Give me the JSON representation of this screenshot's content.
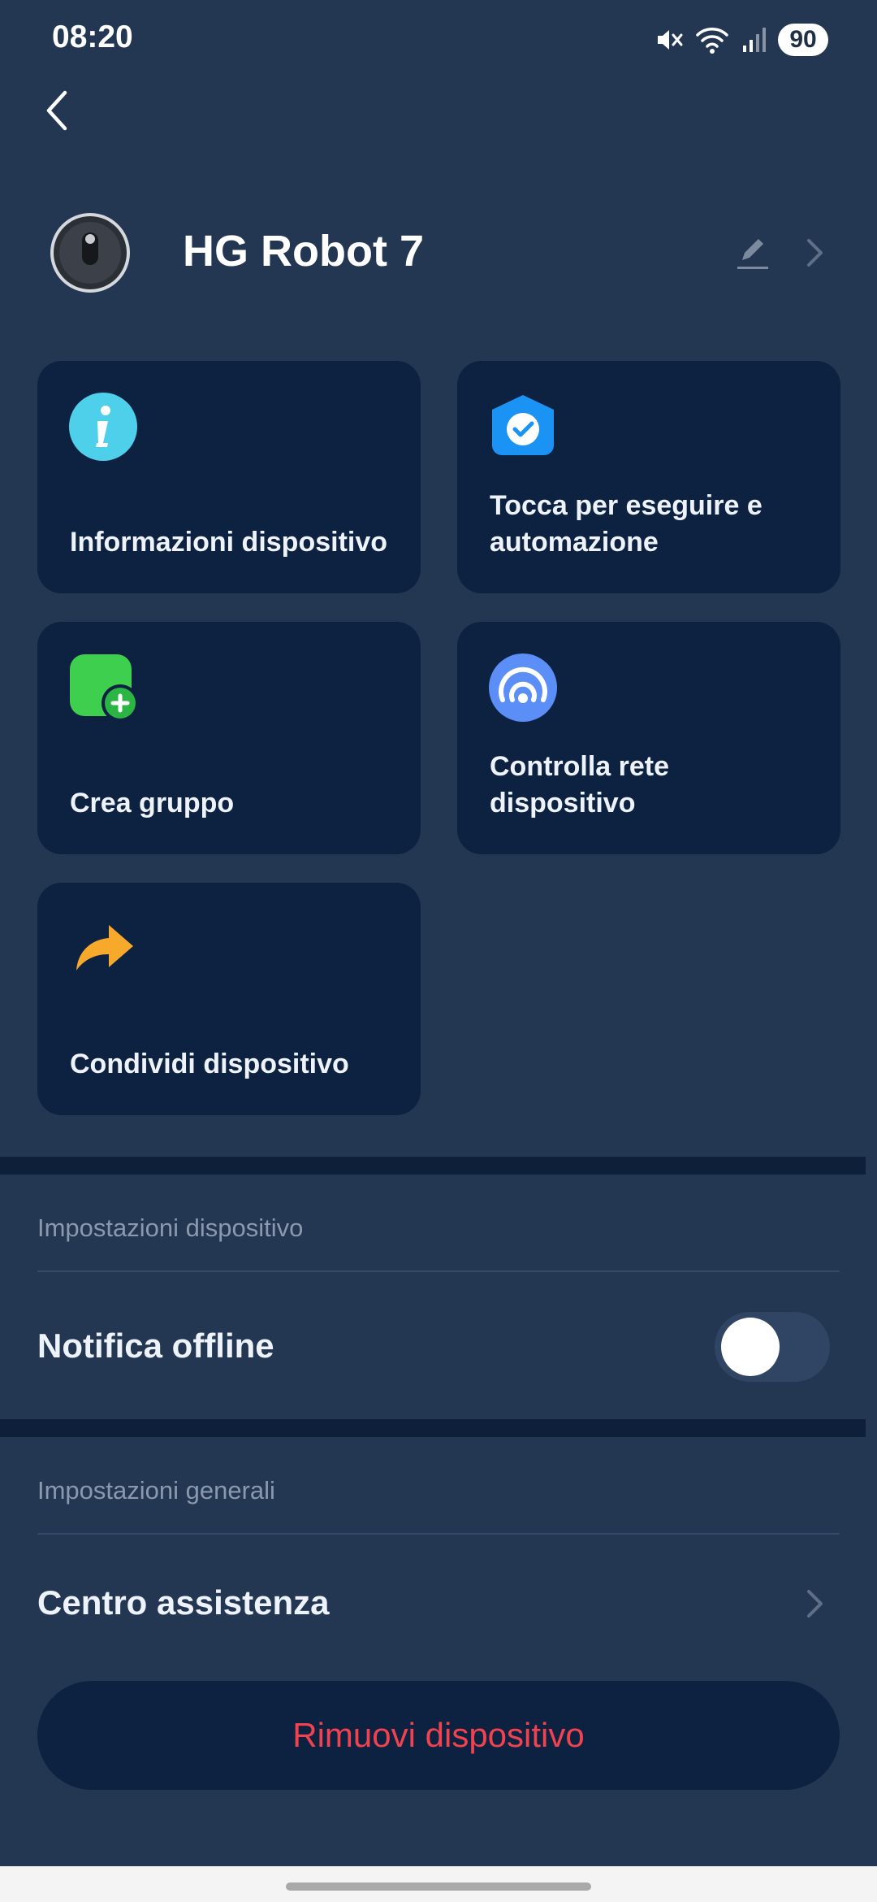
{
  "status_bar": {
    "time": "08:20",
    "battery": "90",
    "icons": [
      "mute-icon",
      "wifi-icon",
      "signal-icon",
      "battery-icon"
    ]
  },
  "device": {
    "name": "HG Robot 7",
    "icons": [
      "robot-vacuum-avatar",
      "edit-icon",
      "chevron-right-icon"
    ]
  },
  "cards": [
    {
      "label": "Informazioni dispositivo",
      "icon": "info-icon",
      "color": "#4fd0ea"
    },
    {
      "label": "Tocca per eseguire e automazione",
      "icon": "checkmark-shield-icon",
      "color": "#1a93f5"
    },
    {
      "label": "Crea gruppo",
      "icon": "add-group-icon",
      "color": "#3fcf4e"
    },
    {
      "label": "Controlla rete dispositivo",
      "icon": "network-check-icon",
      "color": "#5b8ef7"
    },
    {
      "label": "Condividi dispositivo",
      "icon": "share-arrow-icon",
      "color": "#f7a92c"
    }
  ],
  "device_settings": {
    "title": "Impostazioni dispositivo",
    "offline_notification_label": "Notifica offline",
    "offline_notification_enabled": false
  },
  "general_settings": {
    "title": "Impostazioni generali",
    "help_center_label": "Centro assistenza"
  },
  "remove_button": {
    "label": "Rimuovi dispositivo",
    "color": "#f0434f"
  },
  "colors": {
    "background": "#243752",
    "card": "#0d2140",
    "divider": "#0e1f3a"
  }
}
